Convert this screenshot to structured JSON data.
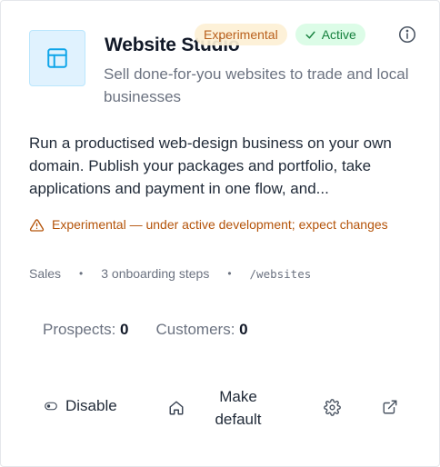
{
  "app": {
    "title": "Website Studio",
    "subtitle": "Sell done-for-you websites to trade and local businesses",
    "description": "Run a productised web-design business on your own domain. Publish your packages and portfolio, take applications and payment in one flow, and...",
    "icon": "layout-icon"
  },
  "badges": {
    "experimental": "Experimental",
    "active": "Active"
  },
  "warning": {
    "text": "Experimental — under active development; expect changes"
  },
  "meta": {
    "category": "Sales",
    "onboarding": "3 onboarding steps",
    "path": "/websites"
  },
  "stats": {
    "prospects_label": "Prospects:",
    "prospects_value": "0",
    "customers_label": "Customers:",
    "customers_value": "0"
  },
  "actions": {
    "disable": "Disable",
    "make_default": "Make default"
  },
  "colors": {
    "icon_bg": "#e0f2fe",
    "icon_stroke": "#0ea5e9",
    "experimental_bg": "#fdf0d5",
    "experimental_text": "#b45309",
    "active_bg": "#dcfce7",
    "active_text": "#15803d",
    "warning": "#b45309"
  }
}
